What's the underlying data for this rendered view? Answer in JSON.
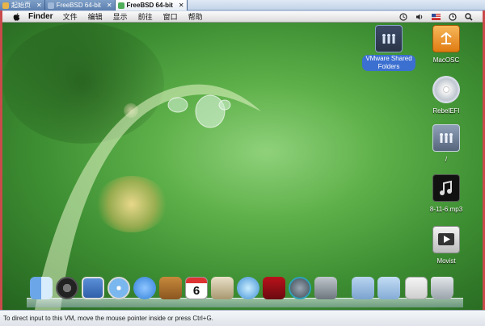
{
  "host_tabs": [
    {
      "label": "起始页",
      "active": false
    },
    {
      "label": "FreeBSD 64-bit",
      "active": false
    },
    {
      "label": "FreeBSD 64-bit",
      "active": true
    }
  ],
  "tab_close_glyph": "✕",
  "menubar": {
    "apple_icon": "apple-icon",
    "items": [
      "Finder",
      "文件",
      "编辑",
      "显示",
      "前往",
      "窗口",
      "帮助"
    ],
    "status_icons": [
      "time-machine-icon",
      "volume-icon",
      "flag-icon",
      "clock-icon",
      "spotlight-icon"
    ]
  },
  "desktop_icons": [
    {
      "label": "VMware Shared Folders",
      "icon": "shared-folder-icon",
      "selected": true
    },
    {
      "label": "MacOSC",
      "icon": "external-drive-icon",
      "selected": false
    },
    {
      "label": "RebelEFI",
      "icon": "disc-icon",
      "selected": false
    },
    {
      "label": "/",
      "icon": "hard-drive-icon",
      "selected": false
    },
    {
      "label": "8-11-6.mp3",
      "icon": "music-file-icon",
      "selected": false
    },
    {
      "label": "Movist",
      "icon": "movie-player-icon",
      "selected": false
    }
  ],
  "dock_items": [
    "finder-icon",
    "dashboard-icon",
    "preview-icon",
    "safari-icon",
    "ichat-icon",
    "address-book-icon",
    "ical-icon",
    "iphoto-icon",
    "itunes-icon",
    "photo-booth-icon",
    "time-machine-icon",
    "system-preferences-icon",
    "applications-folder-icon",
    "documents-folder-icon",
    "downloads-stack-icon",
    "trash-icon"
  ],
  "ical_day": "6",
  "status_bar": "To direct input to this VM, move the mouse pointer inside or press Ctrl+G.",
  "colors": {
    "vm_border": "#c94a4a",
    "selection": "#3b6fd0"
  }
}
